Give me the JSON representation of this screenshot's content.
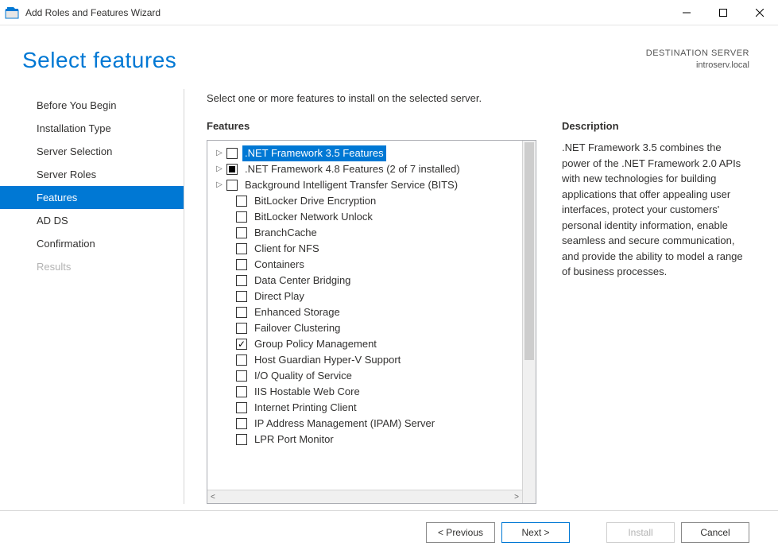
{
  "window_title": "Add Roles and Features Wizard",
  "page_title": "Select features",
  "destination": {
    "label": "DESTINATION SERVER",
    "value": "introserv.local"
  },
  "instruction": "Select one or more features to install on the selected server.",
  "nav": [
    {
      "label": "Before You Begin",
      "state": "normal"
    },
    {
      "label": "Installation Type",
      "state": "normal"
    },
    {
      "label": "Server Selection",
      "state": "normal"
    },
    {
      "label": "Server Roles",
      "state": "normal"
    },
    {
      "label": "Features",
      "state": "selected"
    },
    {
      "label": "AD DS",
      "state": "normal"
    },
    {
      "label": "Confirmation",
      "state": "normal"
    },
    {
      "label": "Results",
      "state": "disabled"
    }
  ],
  "features_heading": "Features",
  "description_heading": "Description",
  "features": [
    {
      "label": ".NET Framework 3.5 Features",
      "expandable": true,
      "check": "unchecked",
      "selected": true
    },
    {
      "label": ".NET Framework 4.8 Features (2 of 7 installed)",
      "expandable": true,
      "check": "indeterminate"
    },
    {
      "label": "Background Intelligent Transfer Service (BITS)",
      "expandable": true,
      "check": "unchecked"
    },
    {
      "label": "BitLocker Drive Encryption",
      "expandable": false,
      "check": "unchecked",
      "indent": true
    },
    {
      "label": "BitLocker Network Unlock",
      "expandable": false,
      "check": "unchecked",
      "indent": true
    },
    {
      "label": "BranchCache",
      "expandable": false,
      "check": "unchecked",
      "indent": true
    },
    {
      "label": "Client for NFS",
      "expandable": false,
      "check": "unchecked",
      "indent": true
    },
    {
      "label": "Containers",
      "expandable": false,
      "check": "unchecked",
      "indent": true
    },
    {
      "label": "Data Center Bridging",
      "expandable": false,
      "check": "unchecked",
      "indent": true
    },
    {
      "label": "Direct Play",
      "expandable": false,
      "check": "unchecked",
      "indent": true
    },
    {
      "label": "Enhanced Storage",
      "expandable": false,
      "check": "unchecked",
      "indent": true
    },
    {
      "label": "Failover Clustering",
      "expandable": false,
      "check": "unchecked",
      "indent": true
    },
    {
      "label": "Group Policy Management",
      "expandable": false,
      "check": "checked",
      "indent": true
    },
    {
      "label": "Host Guardian Hyper-V Support",
      "expandable": false,
      "check": "unchecked",
      "indent": true
    },
    {
      "label": "I/O Quality of Service",
      "expandable": false,
      "check": "unchecked",
      "indent": true
    },
    {
      "label": "IIS Hostable Web Core",
      "expandable": false,
      "check": "unchecked",
      "indent": true
    },
    {
      "label": "Internet Printing Client",
      "expandable": false,
      "check": "unchecked",
      "indent": true
    },
    {
      "label": "IP Address Management (IPAM) Server",
      "expandable": false,
      "check": "unchecked",
      "indent": true
    },
    {
      "label": "LPR Port Monitor",
      "expandable": false,
      "check": "unchecked",
      "indent": true
    }
  ],
  "description_text": ".NET Framework 3.5 combines the power of the .NET Framework 2.0 APIs with new technologies for building applications that offer appealing user interfaces, protect your customers' personal identity information, enable seamless and secure communication, and provide the ability to model a range of business processes.",
  "buttons": {
    "previous": "< Previous",
    "next": "Next >",
    "install": "Install",
    "cancel": "Cancel"
  }
}
